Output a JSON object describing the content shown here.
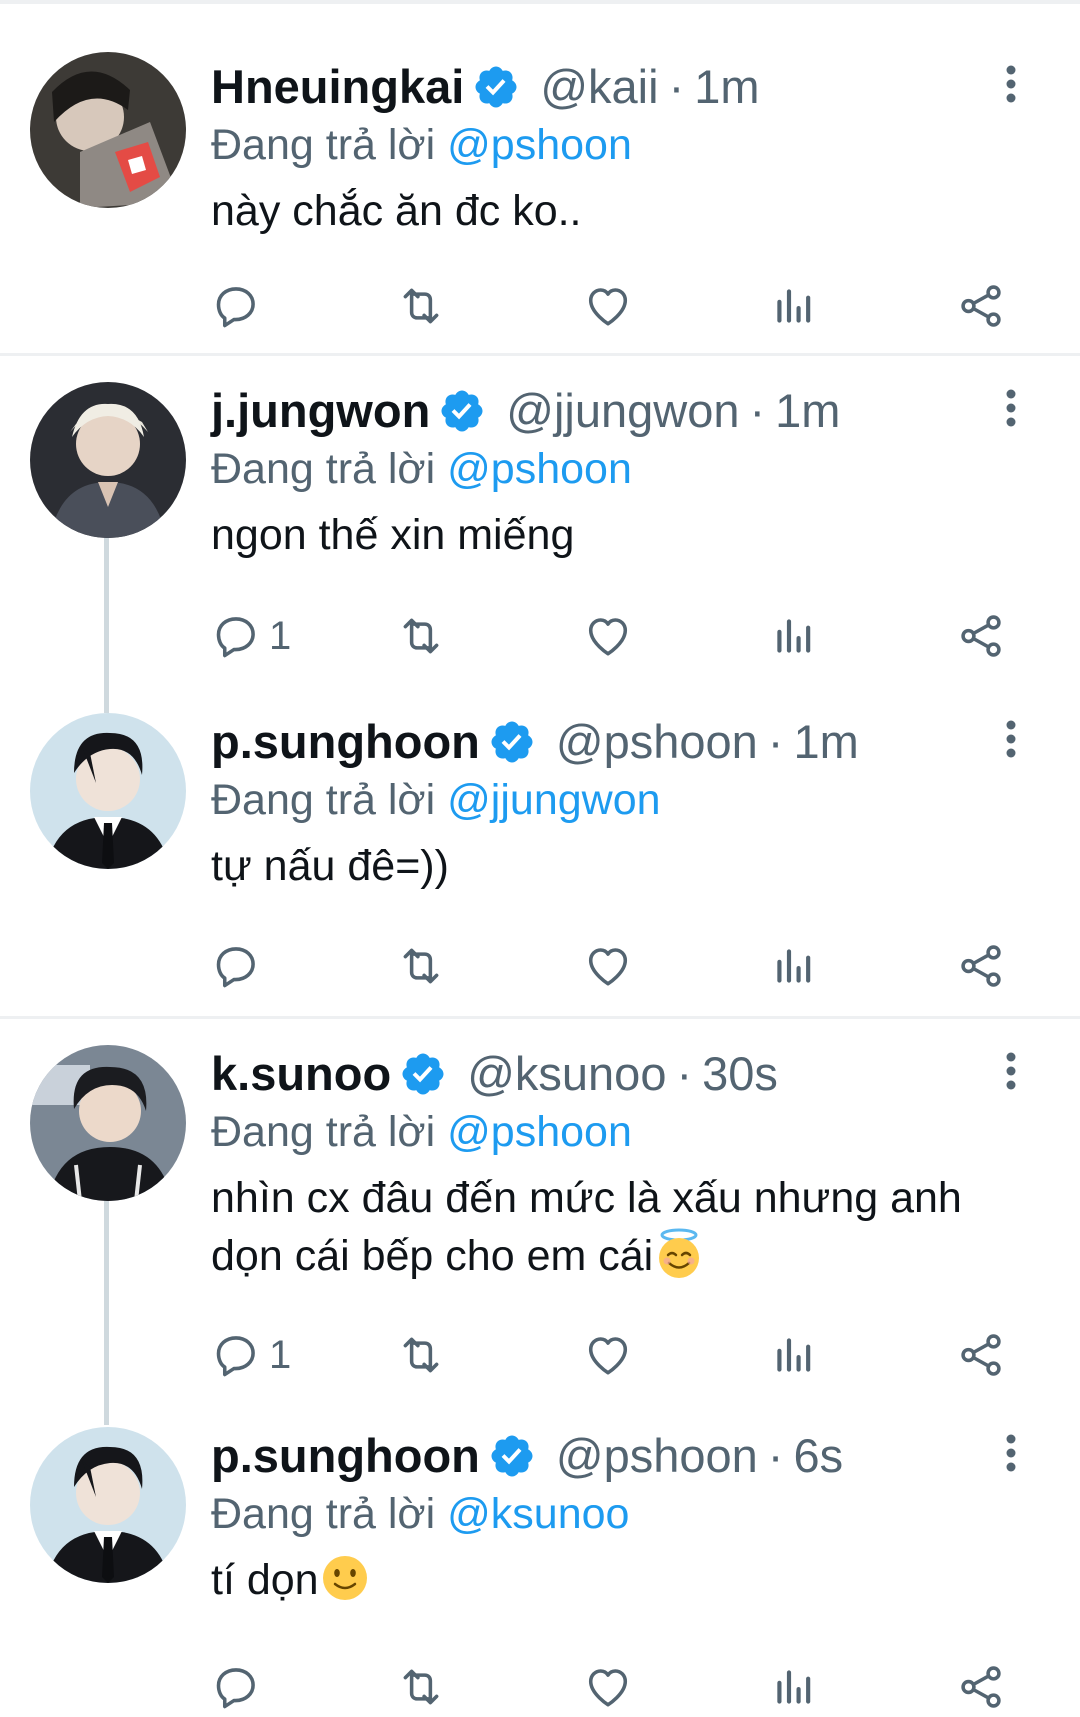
{
  "reply_prefix": "Đang trả lời",
  "tweets": [
    {
      "name": "Hneuingkai",
      "handle": "@kaii",
      "time": "1m",
      "reply_to": "@pshoon",
      "text": "này chắc ăn đc ko..",
      "reply_count": ""
    },
    {
      "name": "j.jungwon",
      "handle": "@jjungwon",
      "time": "1m",
      "reply_to": "@pshoon",
      "text": "ngon thế xin miếng",
      "reply_count": "1"
    },
    {
      "name": "p.sunghoon",
      "handle": "@pshoon",
      "time": "1m",
      "reply_to": "@jjungwon",
      "text": "tự nấu đê=))",
      "reply_count": ""
    },
    {
      "name": "k.sunoo",
      "handle": "@ksunoo",
      "time": "30s",
      "reply_to": "@pshoon",
      "text": "nhìn cx đâu đến mức là xấu nhưng anh dọn cái bếp cho em cái",
      "reply_count": "1",
      "emoji": "smiling-face-with-halo"
    },
    {
      "name": "p.sunghoon",
      "handle": "@pshoon",
      "time": "6s",
      "reply_to": "@ksunoo",
      "text": "tí dọn",
      "reply_count": "",
      "emoji": "slightly-smiling-face"
    }
  ],
  "colors": {
    "accent": "#1d9bf0",
    "secondary_text": "#536471",
    "primary_text": "#0f1419",
    "divider": "#eef0f2"
  },
  "icons": [
    "verified-badge-icon",
    "more-vertical-icon",
    "reply-icon",
    "retweet-icon",
    "like-icon",
    "views-icon",
    "share-icon"
  ]
}
